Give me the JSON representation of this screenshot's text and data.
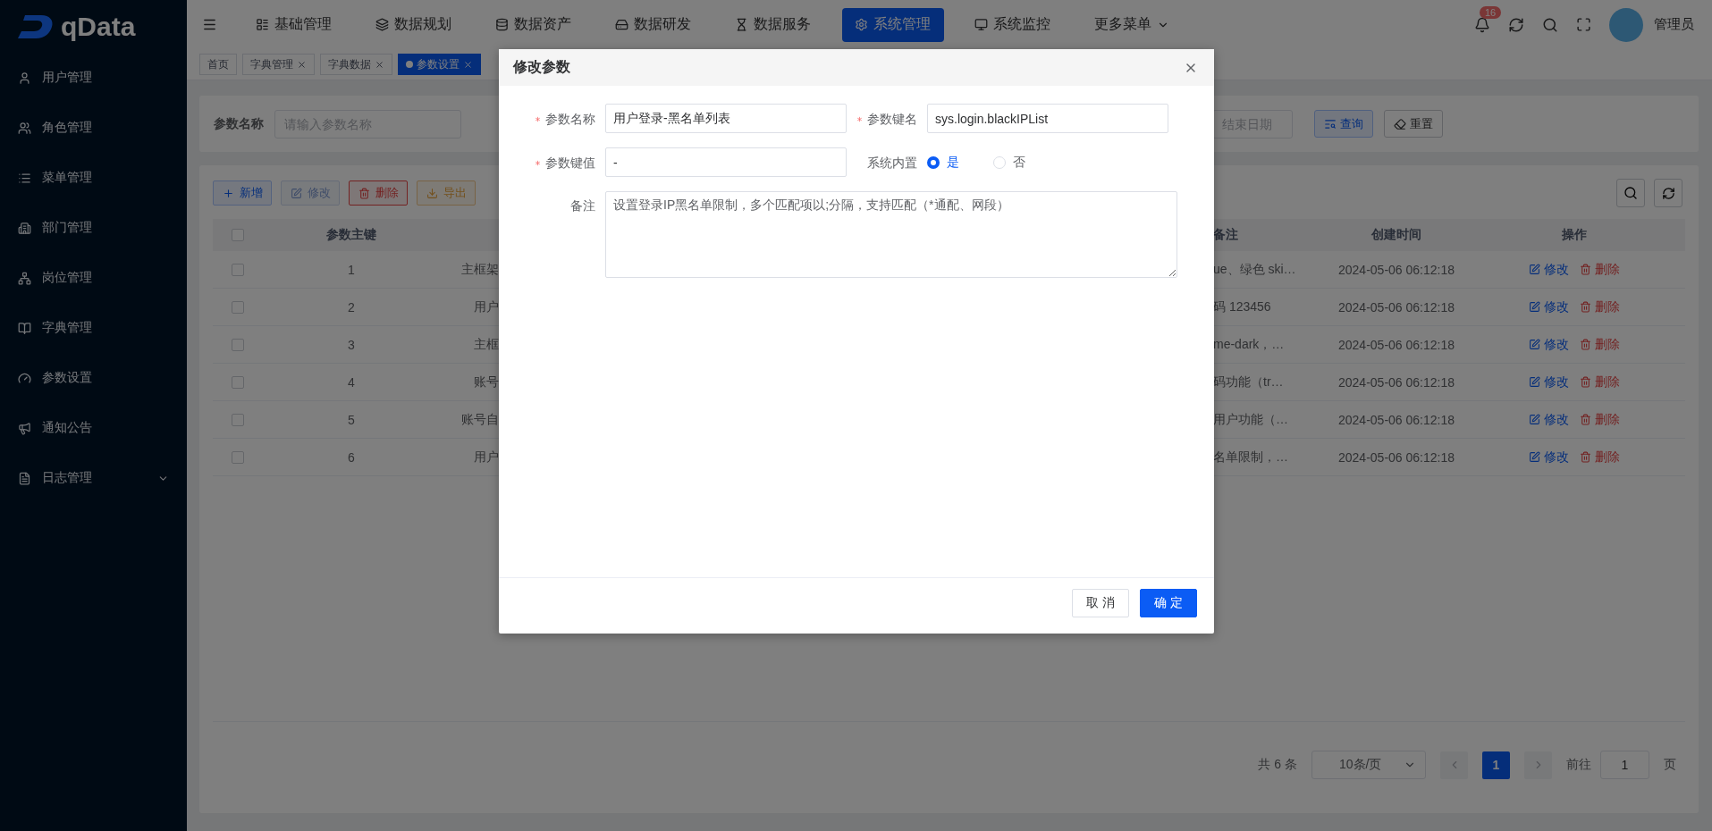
{
  "logo": {
    "text": "qData"
  },
  "sidebar": {
    "items": [
      {
        "label": "用户管理",
        "kind": "link"
      },
      {
        "label": "角色管理",
        "kind": "link"
      },
      {
        "label": "菜单管理",
        "kind": "link"
      },
      {
        "label": "部门管理",
        "kind": "link"
      },
      {
        "label": "岗位管理",
        "kind": "link"
      },
      {
        "label": "字典管理",
        "kind": "link"
      },
      {
        "label": "参数设置",
        "kind": "link"
      },
      {
        "label": "通知公告",
        "kind": "link"
      },
      {
        "label": "日志管理",
        "kind": "group"
      }
    ]
  },
  "top_nav": {
    "items": [
      {
        "label": "基础管理",
        "selected": false
      },
      {
        "label": "数据规划",
        "selected": false
      },
      {
        "label": "数据资产",
        "selected": false
      },
      {
        "label": "数据研发",
        "selected": false
      },
      {
        "label": "数据服务",
        "selected": false
      },
      {
        "label": "系统管理",
        "selected": true
      },
      {
        "label": "系统监控",
        "selected": false
      }
    ],
    "more": {
      "label": "更多菜单"
    }
  },
  "notifications": {
    "badge": "16"
  },
  "user": {
    "name": "管理员"
  },
  "tags": [
    {
      "label": "首页",
      "selected": false,
      "closable": false
    },
    {
      "label": "字典管理",
      "selected": false,
      "closable": true
    },
    {
      "label": "字典数据",
      "selected": false,
      "closable": true
    },
    {
      "label": "参数设置",
      "selected": true,
      "closable": true
    }
  ],
  "search": {
    "label": "参数名称",
    "placeholder": "请输入参数名称",
    "date_end_placeholder": "结束日期",
    "buttons": [
      {
        "label": "查询",
        "kind": "primary"
      },
      {
        "label": "重置",
        "kind": "default"
      }
    ]
  },
  "toolbar": {
    "buttons": [
      {
        "label": "新增",
        "kind": "add",
        "disabled": false
      },
      {
        "label": "修改",
        "kind": "edit",
        "disabled": true
      },
      {
        "label": "删除",
        "kind": "delete",
        "disabled": false
      },
      {
        "label": "导出",
        "kind": "export",
        "disabled": false
      }
    ]
  },
  "table": {
    "header_checked": false,
    "columns": [
      "参数主键",
      "备注",
      "创建时间",
      "操作"
    ],
    "rows": [
      {
        "checked": false,
        "key": "1",
        "name": "主框架",
        "remark": "ue、绿色 ski…",
        "created": "2024-05-06 06:12:18",
        "actions": [
          "修改",
          "删除"
        ]
      },
      {
        "checked": false,
        "key": "2",
        "name": "用户",
        "remark": "码 123456",
        "created": "2024-05-06 06:12:18",
        "actions": [
          "修改",
          "删除"
        ]
      },
      {
        "checked": false,
        "key": "3",
        "name": "主框",
        "remark": "me-dark，…",
        "created": "2024-05-06 06:12:18",
        "actions": [
          "修改",
          "删除"
        ]
      },
      {
        "checked": false,
        "key": "4",
        "name": "账号",
        "remark": "码功能（tr…",
        "created": "2024-05-06 06:12:18",
        "actions": [
          "修改",
          "删除"
        ]
      },
      {
        "checked": false,
        "key": "5",
        "name": "账号自",
        "remark": "用户功能（…",
        "created": "2024-05-06 06:12:18",
        "actions": [
          "修改",
          "删除"
        ]
      },
      {
        "checked": false,
        "key": "6",
        "name": "用户",
        "remark": "名单限制，…",
        "created": "2024-05-06 06:12:18",
        "actions": [
          "修改",
          "删除"
        ]
      }
    ]
  },
  "pagination": {
    "total": "共 6 条",
    "page_size": "10条/页",
    "pages": [
      {
        "label": "1",
        "selected": true
      }
    ],
    "goto_label": "前往",
    "goto_value": "1",
    "page_suffix": "页"
  },
  "dialog": {
    "title": "修改参数",
    "fields": [
      {
        "label": "参数名称",
        "required": true,
        "kind": "input",
        "value": "用户登录-黑名单列表"
      },
      {
        "label": "参数键名",
        "required": true,
        "kind": "input",
        "value": "sys.login.blackIPList"
      },
      {
        "label": "参数键值",
        "required": true,
        "kind": "input",
        "value": "-"
      },
      {
        "label": "系统内置",
        "required": false,
        "kind": "radio",
        "options": [
          {
            "label": "是",
            "selected": true
          },
          {
            "label": "否",
            "selected": false
          }
        ]
      },
      {
        "label": "备注",
        "required": false,
        "kind": "textarea",
        "value": "设置登录IP黑名单限制，多个匹配项以;分隔，支持匹配（*通配、网段）"
      }
    ],
    "buttons": [
      {
        "label": "取 消",
        "kind": "default"
      },
      {
        "label": "确 定",
        "kind": "primary"
      }
    ]
  }
}
